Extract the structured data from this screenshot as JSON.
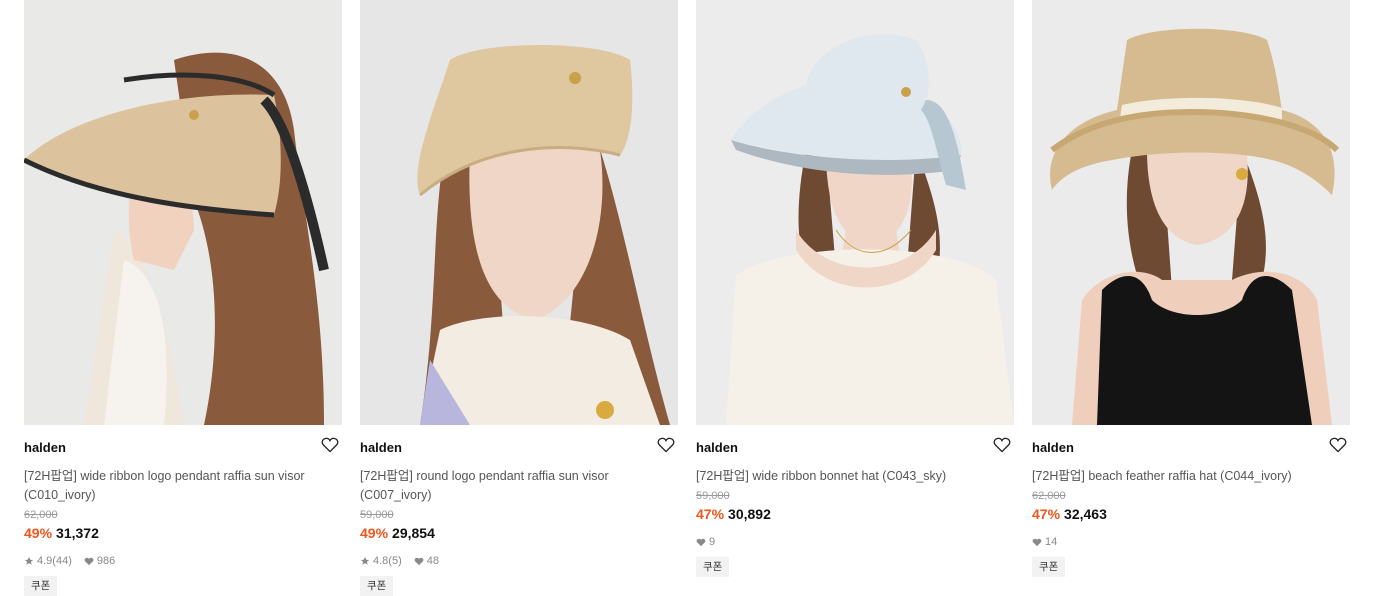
{
  "products": [
    {
      "brand": "halden",
      "title": "[72H팝업] wide ribbon logo pendant raffia sun visor (C010_ivory)",
      "original_price": "62,000",
      "discount": "49%",
      "price": "31,372",
      "rating": "4.9",
      "reviews": "(44)",
      "likes": "986",
      "coupon": "쿠폰"
    },
    {
      "brand": "halden",
      "title": "[72H팝업] round logo pendant raffia sun visor (C007_ivory)",
      "original_price": "59,000",
      "discount": "49%",
      "price": "29,854",
      "rating": "4.8",
      "reviews": "(5)",
      "likes": "48",
      "coupon": "쿠폰"
    },
    {
      "brand": "halden",
      "title": "[72H팝업] wide ribbon bonnet hat (C043_sky)",
      "original_price": "59,000",
      "discount": "47%",
      "price": "30,892",
      "likes": "9",
      "coupon": "쿠폰"
    },
    {
      "brand": "halden",
      "title": "[72H팝업] beach feather raffia hat (C044_ivory)",
      "original_price": "62,000",
      "discount": "47%",
      "price": "32,463",
      "likes": "14",
      "coupon": "쿠폰"
    }
  ],
  "colors": {
    "discount": "#f2551a",
    "background": "#ffffff"
  }
}
